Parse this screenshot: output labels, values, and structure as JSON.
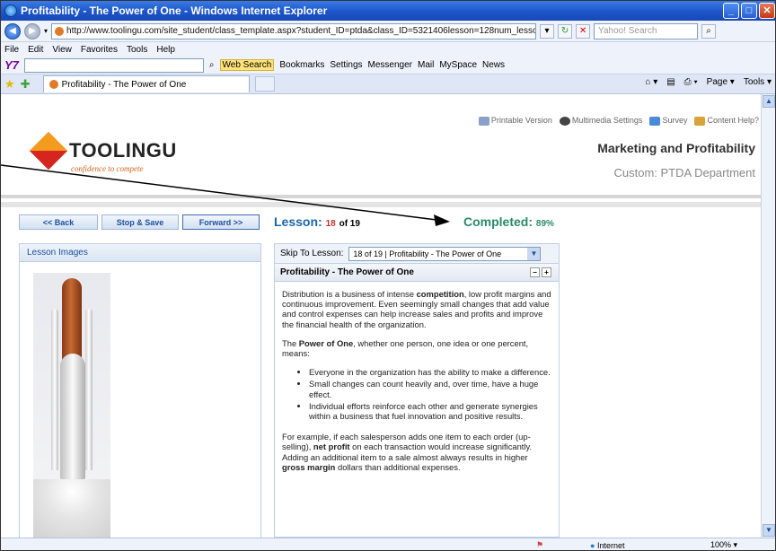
{
  "window": {
    "title": "Profitability - The Power of One - Windows Internet Explorer"
  },
  "address": {
    "url": "http://www.toolingu.com/site_student/class_template.aspx?student_ID=ptda&class_ID=5321406lesson=128num_lessons=",
    "search_placeholder": "Yahoo! Search"
  },
  "menu": [
    "File",
    "Edit",
    "View",
    "Favorites",
    "Tools",
    "Help"
  ],
  "yahoo_toolbar": {
    "logo": "Y7",
    "web_search": "Web Search",
    "items": [
      "Bookmarks",
      "Settings",
      "Messenger",
      "Mail",
      "MySpace",
      "News"
    ]
  },
  "tab": {
    "title": "Profitability - The Power of One"
  },
  "tab_tools": [
    "Page",
    "Tools"
  ],
  "utility": [
    "Printable Version",
    "Multimedia Settings",
    "Survey",
    "Content Help?"
  ],
  "brand": {
    "name": "TOOLINGU",
    "tagline": "confidence to compete"
  },
  "course": {
    "title": "Marketing and Profitability",
    "subtitle": "Custom: PTDA Department"
  },
  "nav_buttons": {
    "back": "<< Back",
    "stop": "Stop & Save",
    "forward": "Forward >>"
  },
  "lesson": {
    "label": "Lesson:",
    "current": "18",
    "of_text": "of 19"
  },
  "completed": {
    "label": "Completed:",
    "value": "89%"
  },
  "images_panel": {
    "title": "Lesson Images"
  },
  "skip": {
    "label": "Skip To Lesson:",
    "selected": "18 of 19 | Profitability - The Power of One"
  },
  "topic": {
    "title": "Profitability - The Power of One"
  },
  "content": {
    "p1_a": "Distribution is a business of intense ",
    "p1_b": "competition",
    "p1_c": ", low profit margins and continuous improvement. Even seemingly small changes that add value and control expenses can help increase sales and profits and improve the financial health of the organization.",
    "p2_a": "The ",
    "p2_b": "Power of One",
    "p2_c": ", whether one person, one idea or one percent, means:",
    "bullets": [
      "Everyone in the organization has the ability to make a difference.",
      "Small changes can count heavily and, over time, have a huge effect.",
      "Individual efforts reinforce each other and generate synergies within a business that fuel innovation and positive results."
    ],
    "p3_a": "For example, if each salesperson adds one item to each order (up-selling), ",
    "p3_b": "net profit",
    "p3_c": " on each transaction would increase significantly. Adding an additional item to a sale almost always results in higher ",
    "p3_d": "gross margin",
    "p3_e": " dollars than additional expenses."
  },
  "status": {
    "zone": "Internet",
    "zoom": "100%"
  }
}
